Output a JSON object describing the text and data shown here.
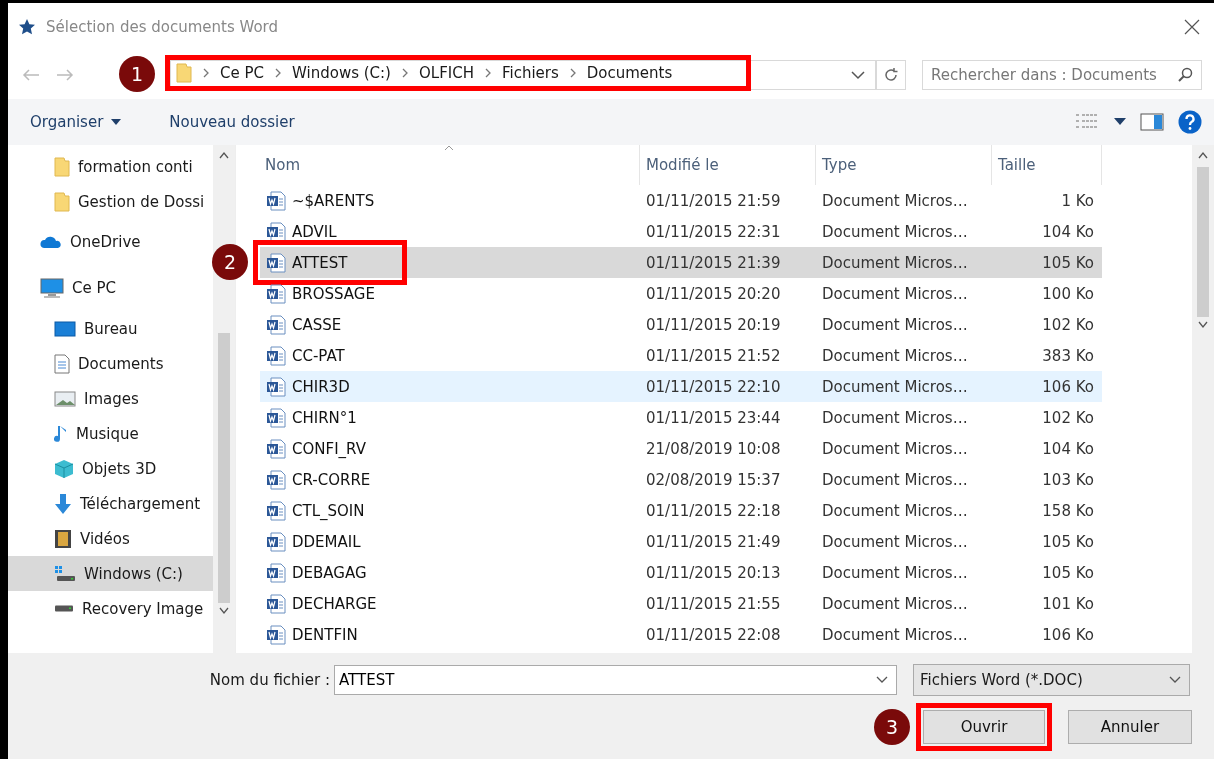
{
  "window": {
    "title": "Sélection des documents Word"
  },
  "address_bar": {
    "step_badge": "1",
    "path": [
      "Ce PC",
      "Windows (C:)",
      "OLFICH",
      "Fichiers",
      "Documents"
    ]
  },
  "search": {
    "placeholder": "Rechercher dans : Documents"
  },
  "toolbar": {
    "organize": "Organiser",
    "new_folder": "Nouveau dossier"
  },
  "sidebar": {
    "partial_children": [
      {
        "label": "formation conti",
        "kind": "folder",
        "selected": false
      },
      {
        "label": "Gestion de Dossi",
        "kind": "folder",
        "selected": false
      }
    ],
    "items": [
      {
        "label": "OneDrive",
        "kind": "cloud",
        "selected": false
      },
      {
        "label": "Ce PC",
        "kind": "pc",
        "selected": false,
        "children": [
          {
            "label": "Bureau",
            "kind": "desktop",
            "selected": false
          },
          {
            "label": "Documents",
            "kind": "documents",
            "selected": false
          },
          {
            "label": "Images",
            "kind": "images",
            "selected": false
          },
          {
            "label": "Musique",
            "kind": "music",
            "selected": false
          },
          {
            "label": "Objets 3D",
            "kind": "cube",
            "selected": false
          },
          {
            "label": "Téléchargement",
            "kind": "download",
            "selected": false
          },
          {
            "label": "Vidéos",
            "kind": "video",
            "selected": false
          },
          {
            "label": "Windows (C:)",
            "kind": "drive-win",
            "selected": true
          },
          {
            "label": "Recovery Image",
            "kind": "drive",
            "selected": false
          }
        ]
      }
    ]
  },
  "table": {
    "columns": [
      "Nom",
      "Modifié le",
      "Type",
      "Taille"
    ],
    "rows": [
      {
        "name": "~$ARENTS",
        "modified": "01/11/2015 21:59",
        "type": "Document Micros…",
        "size": "1 Ko",
        "selected": false,
        "hovered": false
      },
      {
        "name": "ADVIL",
        "modified": "01/11/2015 22:31",
        "type": "Document Micros…",
        "size": "104 Ko",
        "selected": false,
        "hovered": false
      },
      {
        "name": "ATTEST",
        "modified": "01/11/2015 21:39",
        "type": "Document Micros…",
        "size": "105 Ko",
        "selected": true,
        "hovered": false,
        "step_badge": "2"
      },
      {
        "name": "BROSSAGE",
        "modified": "01/11/2015 20:20",
        "type": "Document Micros…",
        "size": "100 Ko",
        "selected": false,
        "hovered": false
      },
      {
        "name": "CASSE",
        "modified": "01/11/2015 20:19",
        "type": "Document Micros…",
        "size": "102 Ko",
        "selected": false,
        "hovered": false
      },
      {
        "name": "CC-PAT",
        "modified": "01/11/2015 21:52",
        "type": "Document Micros…",
        "size": "383 Ko",
        "selected": false,
        "hovered": false
      },
      {
        "name": "CHIR3D",
        "modified": "01/11/2015 22:10",
        "type": "Document Micros…",
        "size": "106 Ko",
        "selected": false,
        "hovered": true
      },
      {
        "name": "CHIRN°1",
        "modified": "01/11/2015 23:44",
        "type": "Document Micros…",
        "size": "102 Ko",
        "selected": false,
        "hovered": false
      },
      {
        "name": "CONFI_RV",
        "modified": "21/08/2019 10:08",
        "type": "Document Micros…",
        "size": "104 Ko",
        "selected": false,
        "hovered": false
      },
      {
        "name": "CR-CORRE",
        "modified": "02/08/2019 15:37",
        "type": "Document Micros…",
        "size": "103 Ko",
        "selected": false,
        "hovered": false
      },
      {
        "name": "CTL_SOIN",
        "modified": "01/11/2015 22:18",
        "type": "Document Micros…",
        "size": "158 Ko",
        "selected": false,
        "hovered": false
      },
      {
        "name": "DDEMAIL",
        "modified": "01/11/2015 21:49",
        "type": "Document Micros…",
        "size": "105 Ko",
        "selected": false,
        "hovered": false
      },
      {
        "name": "DEBAGAG",
        "modified": "01/11/2015 20:13",
        "type": "Document Micros…",
        "size": "105 Ko",
        "selected": false,
        "hovered": false
      },
      {
        "name": "DECHARGE",
        "modified": "01/11/2015 21:55",
        "type": "Document Micros…",
        "size": "101 Ko",
        "selected": false,
        "hovered": false
      },
      {
        "name": "DENTFIN",
        "modified": "01/11/2015 22:08",
        "type": "Document Micros…",
        "size": "106 Ko",
        "selected": false,
        "hovered": false
      }
    ]
  },
  "footer": {
    "open_step_badge": "3",
    "filename_label": "Nom du fichier :",
    "filename": "ATTEST",
    "filter": "Fichiers Word (*.DOC)",
    "buttons": [
      "Ouvrir",
      "Annuler"
    ]
  }
}
